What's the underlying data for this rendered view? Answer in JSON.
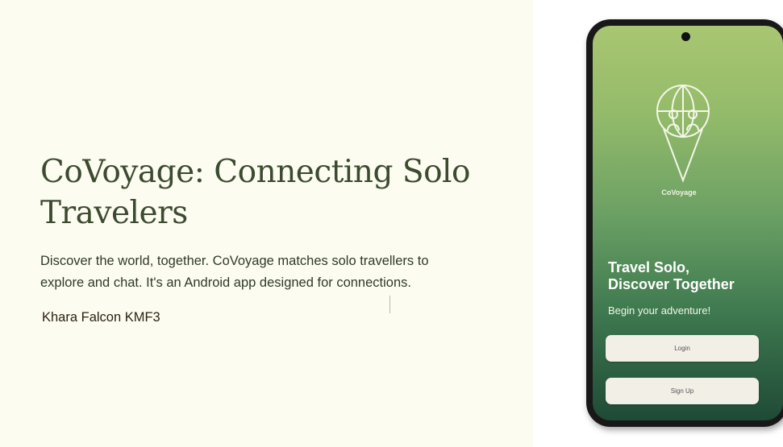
{
  "slide": {
    "title": "CoVoyage: Connecting Solo Travelers",
    "subtitle": "Discover the world, together. CoVoyage matches solo travellers to explore and chat. It's an Android app designed for connections.",
    "author": "Khara Falcon KMF3"
  },
  "phone_app": {
    "brand": "CoVoyage",
    "headline_line1": "Travel Solo,",
    "headline_line2": "Discover Together",
    "tagline": "Begin your adventure!",
    "login_label": "Login",
    "signup_label": "Sign Up",
    "logo_icon": "globe-pin-travelers-icon"
  },
  "colors": {
    "slide_background": "#fcfdf0",
    "title_color": "#3c4a30",
    "screen_gradient_top": "#a9c672",
    "screen_gradient_bottom": "#1f4a36"
  }
}
